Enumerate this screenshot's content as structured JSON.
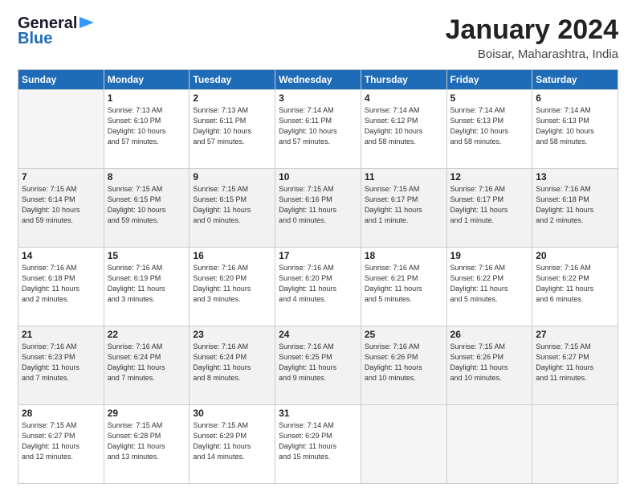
{
  "header": {
    "logo_line1": "General",
    "logo_line2": "Blue",
    "title": "January 2024",
    "subtitle": "Boisar, Maharashtra, India"
  },
  "days_of_week": [
    "Sunday",
    "Monday",
    "Tuesday",
    "Wednesday",
    "Thursday",
    "Friday",
    "Saturday"
  ],
  "weeks": [
    [
      {
        "num": "",
        "info": ""
      },
      {
        "num": "1",
        "info": "Sunrise: 7:13 AM\nSunset: 6:10 PM\nDaylight: 10 hours\nand 57 minutes."
      },
      {
        "num": "2",
        "info": "Sunrise: 7:13 AM\nSunset: 6:11 PM\nDaylight: 10 hours\nand 57 minutes."
      },
      {
        "num": "3",
        "info": "Sunrise: 7:14 AM\nSunset: 6:11 PM\nDaylight: 10 hours\nand 57 minutes."
      },
      {
        "num": "4",
        "info": "Sunrise: 7:14 AM\nSunset: 6:12 PM\nDaylight: 10 hours\nand 58 minutes."
      },
      {
        "num": "5",
        "info": "Sunrise: 7:14 AM\nSunset: 6:13 PM\nDaylight: 10 hours\nand 58 minutes."
      },
      {
        "num": "6",
        "info": "Sunrise: 7:14 AM\nSunset: 6:13 PM\nDaylight: 10 hours\nand 58 minutes."
      }
    ],
    [
      {
        "num": "7",
        "info": "Sunrise: 7:15 AM\nSunset: 6:14 PM\nDaylight: 10 hours\nand 59 minutes."
      },
      {
        "num": "8",
        "info": "Sunrise: 7:15 AM\nSunset: 6:15 PM\nDaylight: 10 hours\nand 59 minutes."
      },
      {
        "num": "9",
        "info": "Sunrise: 7:15 AM\nSunset: 6:15 PM\nDaylight: 11 hours\nand 0 minutes."
      },
      {
        "num": "10",
        "info": "Sunrise: 7:15 AM\nSunset: 6:16 PM\nDaylight: 11 hours\nand 0 minutes."
      },
      {
        "num": "11",
        "info": "Sunrise: 7:15 AM\nSunset: 6:17 PM\nDaylight: 11 hours\nand 1 minute."
      },
      {
        "num": "12",
        "info": "Sunrise: 7:16 AM\nSunset: 6:17 PM\nDaylight: 11 hours\nand 1 minute."
      },
      {
        "num": "13",
        "info": "Sunrise: 7:16 AM\nSunset: 6:18 PM\nDaylight: 11 hours\nand 2 minutes."
      }
    ],
    [
      {
        "num": "14",
        "info": "Sunrise: 7:16 AM\nSunset: 6:18 PM\nDaylight: 11 hours\nand 2 minutes."
      },
      {
        "num": "15",
        "info": "Sunrise: 7:16 AM\nSunset: 6:19 PM\nDaylight: 11 hours\nand 3 minutes."
      },
      {
        "num": "16",
        "info": "Sunrise: 7:16 AM\nSunset: 6:20 PM\nDaylight: 11 hours\nand 3 minutes."
      },
      {
        "num": "17",
        "info": "Sunrise: 7:16 AM\nSunset: 6:20 PM\nDaylight: 11 hours\nand 4 minutes."
      },
      {
        "num": "18",
        "info": "Sunrise: 7:16 AM\nSunset: 6:21 PM\nDaylight: 11 hours\nand 5 minutes."
      },
      {
        "num": "19",
        "info": "Sunrise: 7:16 AM\nSunset: 6:22 PM\nDaylight: 11 hours\nand 5 minutes."
      },
      {
        "num": "20",
        "info": "Sunrise: 7:16 AM\nSunset: 6:22 PM\nDaylight: 11 hours\nand 6 minutes."
      }
    ],
    [
      {
        "num": "21",
        "info": "Sunrise: 7:16 AM\nSunset: 6:23 PM\nDaylight: 11 hours\nand 7 minutes."
      },
      {
        "num": "22",
        "info": "Sunrise: 7:16 AM\nSunset: 6:24 PM\nDaylight: 11 hours\nand 7 minutes."
      },
      {
        "num": "23",
        "info": "Sunrise: 7:16 AM\nSunset: 6:24 PM\nDaylight: 11 hours\nand 8 minutes."
      },
      {
        "num": "24",
        "info": "Sunrise: 7:16 AM\nSunset: 6:25 PM\nDaylight: 11 hours\nand 9 minutes."
      },
      {
        "num": "25",
        "info": "Sunrise: 7:16 AM\nSunset: 6:26 PM\nDaylight: 11 hours\nand 10 minutes."
      },
      {
        "num": "26",
        "info": "Sunrise: 7:15 AM\nSunset: 6:26 PM\nDaylight: 11 hours\nand 10 minutes."
      },
      {
        "num": "27",
        "info": "Sunrise: 7:15 AM\nSunset: 6:27 PM\nDaylight: 11 hours\nand 11 minutes."
      }
    ],
    [
      {
        "num": "28",
        "info": "Sunrise: 7:15 AM\nSunset: 6:27 PM\nDaylight: 11 hours\nand 12 minutes."
      },
      {
        "num": "29",
        "info": "Sunrise: 7:15 AM\nSunset: 6:28 PM\nDaylight: 11 hours\nand 13 minutes."
      },
      {
        "num": "30",
        "info": "Sunrise: 7:15 AM\nSunset: 6:29 PM\nDaylight: 11 hours\nand 14 minutes."
      },
      {
        "num": "31",
        "info": "Sunrise: 7:14 AM\nSunset: 6:29 PM\nDaylight: 11 hours\nand 15 minutes."
      },
      {
        "num": "",
        "info": ""
      },
      {
        "num": "",
        "info": ""
      },
      {
        "num": "",
        "info": ""
      }
    ]
  ]
}
